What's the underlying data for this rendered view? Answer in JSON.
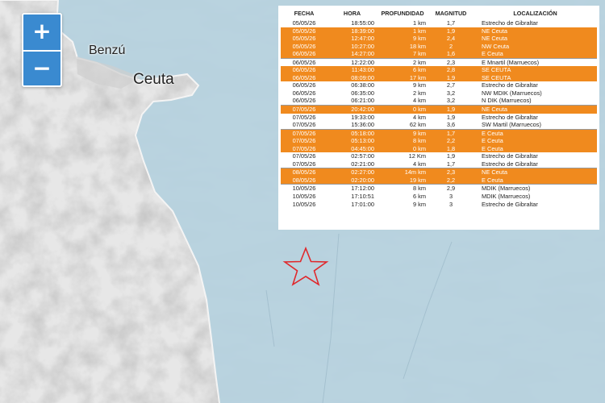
{
  "map": {
    "zoom_in_label": "+",
    "zoom_out_label": "−",
    "places": [
      "Benzú",
      "Ceuta"
    ],
    "colors": {
      "sea": "#b9d3df",
      "land": "#e6e6e6",
      "highlight": "#f08a1e",
      "star": "#e0282c"
    }
  },
  "table": {
    "headers": [
      "FECHA",
      "HORA",
      "PROFUNDIDAD",
      "MAGNITUD",
      "LOCALIZACIÓN"
    ],
    "rows": [
      {
        "fecha": "05/05/26",
        "hora": "18:55:00",
        "prof": "1 km",
        "mag": "1,7",
        "loc": "Estrecho de  Gibraltar",
        "hl": false
      },
      {
        "fecha": "05/05/26",
        "hora": "18:39:00",
        "prof": "1 km",
        "mag": "1,9",
        "loc": "NE Ceuta",
        "hl": true
      },
      {
        "fecha": "05/05/26",
        "hora": "12:47:00",
        "prof": "9 km",
        "mag": "2,4",
        "loc": "NE Ceuta",
        "hl": true
      },
      {
        "fecha": "05/05/26",
        "hora": "10:27:00",
        "prof": "18 km",
        "mag": "2",
        "loc": "NW Ceuta",
        "hl": true
      },
      {
        "fecha": "06/05/26",
        "hora": "14:27:00",
        "prof": "7 km",
        "mag": "1,6",
        "loc": "E Ceuta",
        "hl": true
      },
      {
        "fecha": "06/05/26",
        "hora": "12:22:00",
        "prof": "2 km",
        "mag": "2,3",
        "loc": "E Mnartil (Marruecos)",
        "hl": false
      },
      {
        "fecha": "06/05/26",
        "hora": "11:43:00",
        "prof": "6 km",
        "mag": "2,8",
        "loc": "SE CEUTA",
        "hl": true
      },
      {
        "fecha": "06/05/26",
        "hora": "08:09:00",
        "prof": "17 km",
        "mag": "1,9",
        "loc": "SE CEUTA",
        "hl": true
      },
      {
        "fecha": "06/05/26",
        "hora": "06:38:00",
        "prof": "9 km",
        "mag": "2,7",
        "loc": "Estrecho de  Gibraltar",
        "hl": false
      },
      {
        "fecha": "06/05/26",
        "hora": "06:35:00",
        "prof": "2 km",
        "mag": "3,2",
        "loc": "NW MDIK (Marruecos)",
        "hl": false
      },
      {
        "fecha": "06/05/26",
        "hora": "06:21:00",
        "prof": "4 km",
        "mag": "3,2",
        "loc": "N DIK (Marruecos)",
        "hl": false
      },
      {
        "fecha": "07/05/26",
        "hora": "20:42:00",
        "prof": "0 km",
        "mag": "1,9",
        "loc": "NE Ceuta",
        "hl": true
      },
      {
        "fecha": "07/05/26",
        "hora": "19:33:00",
        "prof": "4 km",
        "mag": "1,9",
        "loc": "Estrecho de  Gibraltar",
        "hl": false
      },
      {
        "fecha": "07/05/26",
        "hora": "15:36:00",
        "prof": "62 km",
        "mag": "3,6",
        "loc": "SW Martil (Marruecos)",
        "hl": false
      },
      {
        "fecha": "07/05/26",
        "hora": "05:18:00",
        "prof": "9 km",
        "mag": "1,7",
        "loc": "E Ceuta",
        "hl": true
      },
      {
        "fecha": "07/05/26",
        "hora": "05:13:00",
        "prof": "8 km",
        "mag": "2,2",
        "loc": "E Ceuta",
        "hl": true
      },
      {
        "fecha": "07/05/26",
        "hora": "04:45:00",
        "prof": "0 km",
        "mag": "1,8",
        "loc": "E Ceuta",
        "hl": true
      },
      {
        "fecha": "07/05/26",
        "hora": "02:57:00",
        "prof": "12 Km",
        "mag": "1,9",
        "loc": "Estrecho de  Gibraltar",
        "hl": false
      },
      {
        "fecha": "07/05/26",
        "hora": "02:21:00",
        "prof": "4 km",
        "mag": "1,7",
        "loc": "Estrecho de  Gibraltar",
        "hl": false
      },
      {
        "fecha": "08/05/26",
        "hora": "02:27:00",
        "prof": "14m km",
        "mag": "2,3",
        "loc": "NE Ceuta",
        "hl": true
      },
      {
        "fecha": "08/05/26",
        "hora": "02:20:00",
        "prof": "19 km",
        "mag": "2,2",
        "loc": "E Ceuta",
        "hl": true
      },
      {
        "fecha": "10/05/26",
        "hora": "17:12:00",
        "prof": "8 km",
        "mag": "2,9",
        "loc": "MDIK (Marruecos)",
        "hl": false
      },
      {
        "fecha": "10/05/26",
        "hora": "17:10:51",
        "prof": "6 km",
        "mag": "3",
        "loc": "MDIK (Marruecos)",
        "hl": false
      },
      {
        "fecha": "10/05/26",
        "hora": "17:01:00",
        "prof": "9 km",
        "mag": "3",
        "loc": "Estrecho de Gibraltar",
        "hl": false
      }
    ]
  }
}
